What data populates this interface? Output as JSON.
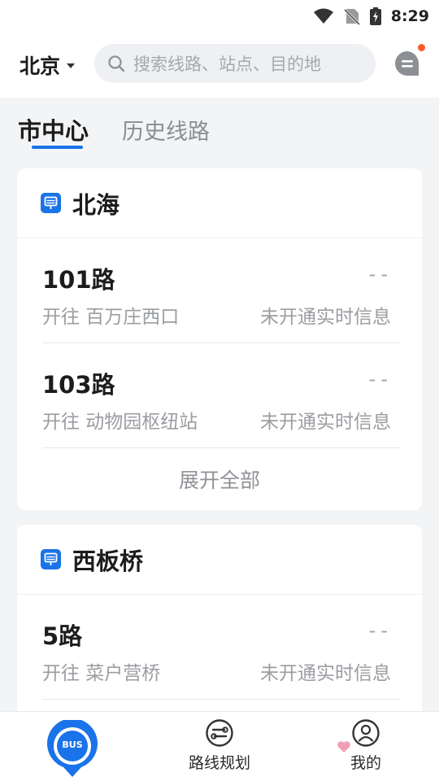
{
  "status_bar": {
    "time": "8:29"
  },
  "header": {
    "city": "北京",
    "search_placeholder": "搜索线路、站点、目的地"
  },
  "tabs": [
    {
      "label": "市中心"
    },
    {
      "label": "历史线路"
    }
  ],
  "stops": [
    {
      "name": "北海",
      "routes": [
        {
          "name": "101路",
          "destination": "开往 百万庄西口",
          "eta": "--",
          "status": "未开通实时信息"
        },
        {
          "name": "103路",
          "destination": "开往 动物园枢纽站",
          "eta": "--",
          "status": "未开通实时信息"
        }
      ],
      "expand_label": "展开全部"
    },
    {
      "name": "西板桥",
      "routes": [
        {
          "name": "5路",
          "destination": "开往 菜户营桥",
          "eta": "--",
          "status": "未开通实时信息"
        }
      ]
    }
  ],
  "bottom_nav": {
    "bus_badge": "BUS",
    "plan_label": "路线规划",
    "mine_label": "我的"
  },
  "colors": {
    "accent": "#1a73e8",
    "notification_dot": "#ff5a2b"
  }
}
